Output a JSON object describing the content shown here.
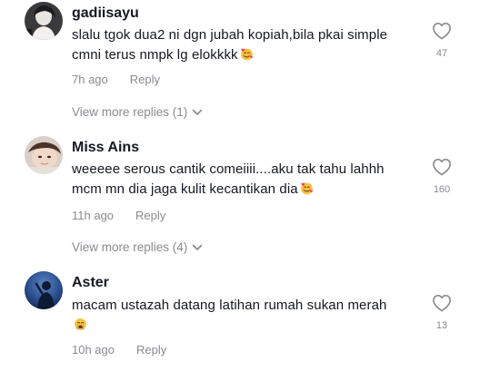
{
  "comments": [
    {
      "username": "gadiisayu",
      "text": "slalu tgok dua2 ni dgn jubah kopiah,bila pkai simple cmni terus nmpk lg elokkkk",
      "emoji": "smiling-face-with-hearts",
      "time": "7h ago",
      "reply_label": "Reply",
      "likes": "47",
      "view_more": "View more replies (1)"
    },
    {
      "username": "Miss Ains",
      "text": "weeeee serous cantik comeiiii....aku tak tahu lahhh mcm mn dia jaga kulit kecantikan dia",
      "emoji": "smiling-face-with-hearts",
      "time": "11h ago",
      "reply_label": "Reply",
      "likes": "160",
      "view_more": "View more replies (4)"
    },
    {
      "username": "Aster",
      "text": "macam ustazah datang latihan rumah sukan merah",
      "emoji": "crying-face",
      "time": "10h ago",
      "reply_label": "Reply",
      "likes": "13"
    }
  ],
  "colors": {
    "text": "#161823",
    "muted": "#8a8b91",
    "heart": "#8a8b91"
  }
}
